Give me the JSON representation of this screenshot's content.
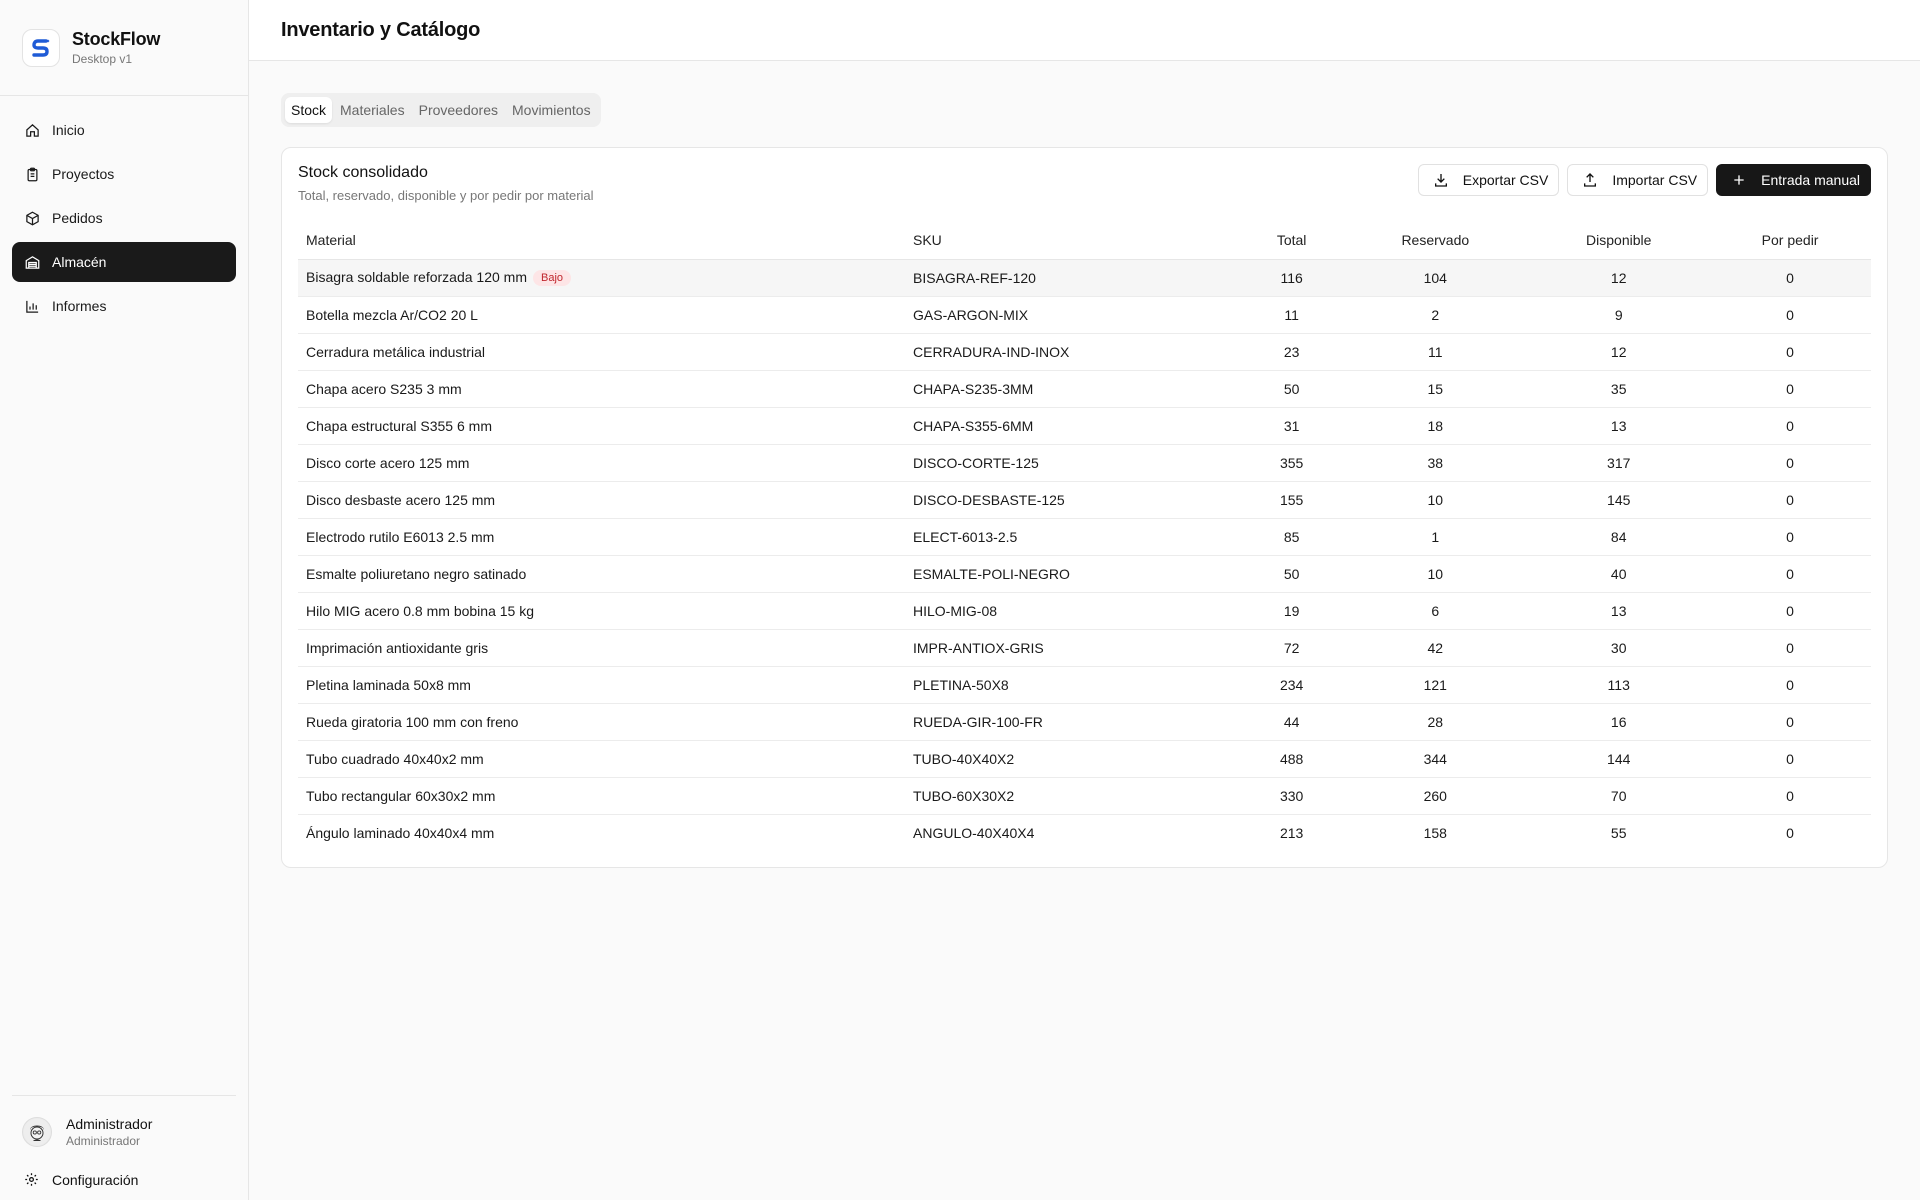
{
  "brand": {
    "name": "StockFlow",
    "subtitle": "Desktop v1"
  },
  "nav": [
    {
      "label": "Inicio",
      "icon": "home-icon",
      "active": false
    },
    {
      "label": "Proyectos",
      "icon": "clipboard-icon",
      "active": false
    },
    {
      "label": "Pedidos",
      "icon": "package-icon",
      "active": false
    },
    {
      "label": "Almacén",
      "icon": "warehouse-icon",
      "active": true
    },
    {
      "label": "Informes",
      "icon": "bar-chart-icon",
      "active": false
    }
  ],
  "user": {
    "name": "Administrador",
    "role": "Administrador"
  },
  "settings_label": "Configuración",
  "page_title": "Inventario y Catálogo",
  "tabs": [
    {
      "label": "Stock",
      "active": true
    },
    {
      "label": "Materiales",
      "active": false
    },
    {
      "label": "Proveedores",
      "active": false
    },
    {
      "label": "Movimientos",
      "active": false
    }
  ],
  "card": {
    "title": "Stock consolidado",
    "subtitle": "Total, reservado, disponible y por pedir por material",
    "export_label": "Exportar CSV",
    "import_label": "Importar CSV",
    "manual_label": "Entrada manual"
  },
  "table": {
    "headers": {
      "material": "Material",
      "sku": "SKU",
      "total": "Total",
      "reserved": "Reservado",
      "available": "Disponible",
      "to_order": "Por pedir"
    },
    "low_badge": "Bajo",
    "rows": [
      {
        "material": "Bisagra soldable reforzada 120 mm",
        "sku": "BISAGRA-REF-120",
        "total": "116",
        "reserved": "104",
        "available": "12",
        "to_order": "0",
        "low": true
      },
      {
        "material": "Botella mezcla Ar/CO2 20 L",
        "sku": "GAS-ARGON-MIX",
        "total": "11",
        "reserved": "2",
        "available": "9",
        "to_order": "0",
        "low": false
      },
      {
        "material": "Cerradura metálica industrial",
        "sku": "CERRADURA-IND-INOX",
        "total": "23",
        "reserved": "11",
        "available": "12",
        "to_order": "0",
        "low": false
      },
      {
        "material": "Chapa acero S235 3 mm",
        "sku": "CHAPA-S235-3MM",
        "total": "50",
        "reserved": "15",
        "available": "35",
        "to_order": "0",
        "low": false
      },
      {
        "material": "Chapa estructural S355 6 mm",
        "sku": "CHAPA-S355-6MM",
        "total": "31",
        "reserved": "18",
        "available": "13",
        "to_order": "0",
        "low": false
      },
      {
        "material": "Disco corte acero 125 mm",
        "sku": "DISCO-CORTE-125",
        "total": "355",
        "reserved": "38",
        "available": "317",
        "to_order": "0",
        "low": false
      },
      {
        "material": "Disco desbaste acero 125 mm",
        "sku": "DISCO-DESBASTE-125",
        "total": "155",
        "reserved": "10",
        "available": "145",
        "to_order": "0",
        "low": false
      },
      {
        "material": "Electrodo rutilo E6013 2.5 mm",
        "sku": "ELECT-6013-2.5",
        "total": "85",
        "reserved": "1",
        "available": "84",
        "to_order": "0",
        "low": false
      },
      {
        "material": "Esmalte poliuretano negro satinado",
        "sku": "ESMALTE-POLI-NEGRO",
        "total": "50",
        "reserved": "10",
        "available": "40",
        "to_order": "0",
        "low": false
      },
      {
        "material": "Hilo MIG acero 0.8 mm bobina 15 kg",
        "sku": "HILO-MIG-08",
        "total": "19",
        "reserved": "6",
        "available": "13",
        "to_order": "0",
        "low": false
      },
      {
        "material": "Imprimación antioxidante gris",
        "sku": "IMPR-ANTIOX-GRIS",
        "total": "72",
        "reserved": "42",
        "available": "30",
        "to_order": "0",
        "low": false
      },
      {
        "material": "Pletina laminada 50x8 mm",
        "sku": "PLETINA-50X8",
        "total": "234",
        "reserved": "121",
        "available": "113",
        "to_order": "0",
        "low": false
      },
      {
        "material": "Rueda giratoria 100 mm con freno",
        "sku": "RUEDA-GIR-100-FR",
        "total": "44",
        "reserved": "28",
        "available": "16",
        "to_order": "0",
        "low": false
      },
      {
        "material": "Tubo cuadrado 40x40x2 mm",
        "sku": "TUBO-40X40X2",
        "total": "488",
        "reserved": "344",
        "available": "144",
        "to_order": "0",
        "low": false
      },
      {
        "material": "Tubo rectangular 60x30x2 mm",
        "sku": "TUBO-60X30X2",
        "total": "330",
        "reserved": "260",
        "available": "70",
        "to_order": "0",
        "low": false
      },
      {
        "material": "Ángulo laminado 40x40x4 mm",
        "sku": "ANGULO-40X40X4",
        "total": "213",
        "reserved": "158",
        "available": "55",
        "to_order": "0",
        "low": false
      }
    ]
  },
  "colors": {
    "accent": "#1a1a1a",
    "brand_blue": "#1f5bd6",
    "low_badge_text": "#c0262d",
    "low_badge_bg": "#fde5e6"
  }
}
